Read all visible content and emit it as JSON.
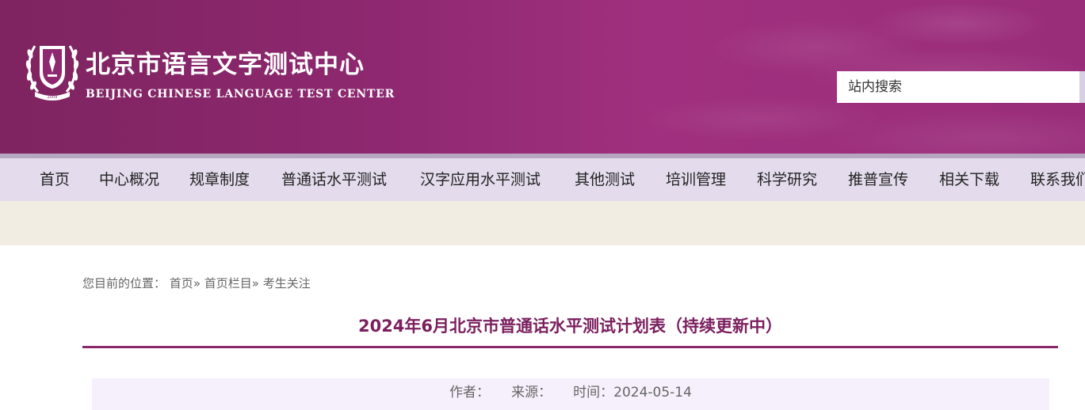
{
  "header": {
    "title": "北京市语言文字测试中心",
    "subtitle": "BEIJING CHINESE LANGUAGE TEST CENTER",
    "logo_icon": "laurel-emblem-icon",
    "search_placeholder": "站内搜索"
  },
  "nav": {
    "items": [
      {
        "label": "首页"
      },
      {
        "label": "中心概况"
      },
      {
        "label": "规章制度"
      },
      {
        "label": "普通话水平测试"
      },
      {
        "label": "汉字应用水平测试"
      },
      {
        "label": "其他测试"
      },
      {
        "label": "培训管理"
      },
      {
        "label": "科学研究"
      },
      {
        "label": "推普宣传"
      },
      {
        "label": "相关下载"
      },
      {
        "label": "联系我们"
      }
    ]
  },
  "breadcrumb": {
    "prefix": "您目前的位置：",
    "items": [
      "首页",
      "首页栏目",
      "考生关注"
    ],
    "separator": "»"
  },
  "article": {
    "title": "2024年6月北京市普通话水平测试计划表（持续更新中）",
    "author_label": "作者：",
    "source_label": "来源：",
    "time_label": "时间：",
    "time_value": "2024-05-14"
  },
  "colors": {
    "brand": "#8a2a6c",
    "nav_bg": "#e4dced",
    "subbar_bg": "#f1ede3",
    "meta_bg": "#f6f0fc"
  }
}
